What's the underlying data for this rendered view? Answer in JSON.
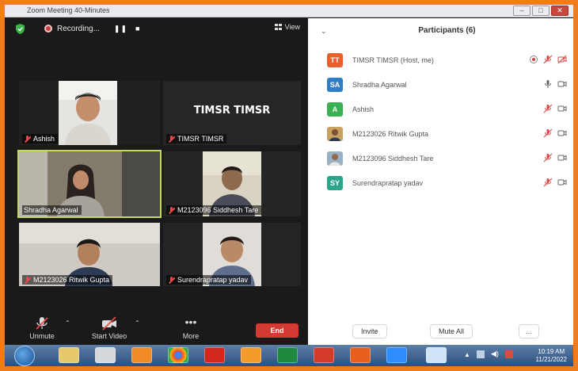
{
  "window": {
    "title": "Zoom Meeting 40-Minutes"
  },
  "topbar": {
    "recording_label": "Recording...",
    "pause_glyph": "❚❚",
    "stop_glyph": "■",
    "view_label": "View"
  },
  "tiles": [
    {
      "name": "Ashish",
      "muted": true
    },
    {
      "name": "TIMSR TIMSR",
      "display": "TIMSR TIMSR",
      "muted": true
    },
    {
      "name": "Shradha Agarwal",
      "muted": false,
      "active": true
    },
    {
      "name": "M2123096 Siddhesh Tare",
      "muted": true
    },
    {
      "name": "M2123026 Ritwik Gupta",
      "muted": true
    },
    {
      "name": "Surendrapratap yadav",
      "muted": true
    }
  ],
  "controls": {
    "unmute": "Unmute",
    "start_video": "Start Video",
    "more": "More",
    "end": "End"
  },
  "participants": {
    "title": "Participants (6)",
    "list": [
      {
        "initials": "TT",
        "color": "#e8612c",
        "name": "TIMSR TIMSR (Host, me)",
        "mic": "muted",
        "video": "off",
        "extra": "record"
      },
      {
        "initials": "SA",
        "color": "#2f7ec9",
        "name": "Shradha Agarwal",
        "mic": "on",
        "video": "on"
      },
      {
        "initials": "A",
        "color": "#3cb054",
        "name": "Ashish",
        "mic": "muted",
        "video": "on"
      },
      {
        "initials": "",
        "color": "#c9a060",
        "name": "M2123026 Ritwik Gupta",
        "mic": "muted",
        "video": "on"
      },
      {
        "initials": "",
        "color": "#9ab0c4",
        "name": "M2123096 Siddhesh Tare",
        "mic": "muted",
        "video": "on"
      },
      {
        "initials": "SY",
        "color": "#29a58c",
        "name": "Surendrapratap yadav",
        "mic": "muted",
        "video": "on"
      }
    ],
    "invite": "Invite",
    "mute_all": "Mute All",
    "more": "..."
  },
  "taskbar": {
    "time": "10:19 AM",
    "date": "11/21/2022"
  }
}
